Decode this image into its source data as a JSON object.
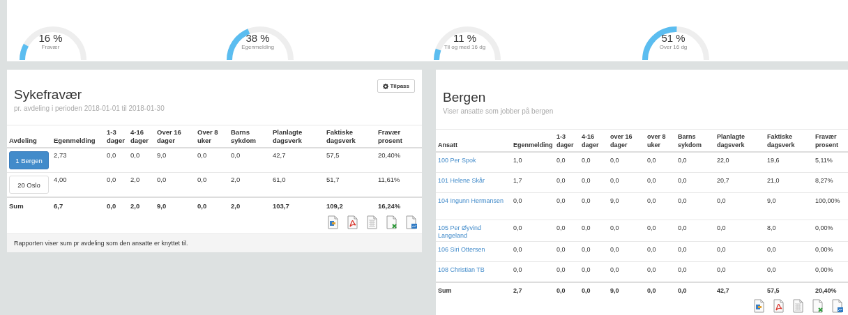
{
  "gauges": [
    {
      "value": "16 %",
      "label": "Fravær"
    },
    {
      "value": "38 %",
      "label": "Egenmelding"
    },
    {
      "value": "11 %",
      "label": "Til og med 16 dg"
    },
    {
      "value": "51 %",
      "label": "Over 16 dg"
    }
  ],
  "department_panel": {
    "title": "Sykefravær",
    "subtitle": "pr. avdeling i perioden 2018-01-01 til 2018-01-30",
    "customize_button": "Tilpass",
    "columns": [
      "Avdeling",
      "Egenmelding",
      "1-3 dager",
      "4-16 dager",
      "Over 16 dager",
      "Over 8 uker",
      "Barns sykdom",
      "Planlagte dagsverk",
      "Faktiske dagsverk",
      "Fravær prosent"
    ],
    "rows": [
      {
        "selected": true,
        "cells": [
          "1 Bergen",
          "2,73",
          "0,0",
          "0,0",
          "9,0",
          "0,0",
          "0,0",
          "42,7",
          "57,5",
          "20,40%"
        ]
      },
      {
        "selected": false,
        "cells": [
          "20 Oslo",
          "4,00",
          "0,0",
          "2,0",
          "0,0",
          "0,0",
          "2,0",
          "61,0",
          "51,7",
          "11,61%"
        ]
      }
    ],
    "sum": [
      "Sum",
      "6,7",
      "0,0",
      "2,0",
      "9,0",
      "0,0",
      "2,0",
      "103,7",
      "109,2",
      "16,24%"
    ],
    "footer": "Rapporten viser sum pr avdeling som den ansatte er knyttet til."
  },
  "employee_panel": {
    "title": "Bergen",
    "subtitle": "Viser ansatte som jobber på bergen",
    "columns": [
      "Ansatt",
      "Egenmelding",
      "1-3 dager",
      "4-16 dager",
      "over 16 dager",
      "over 8 uker",
      "Barns sykdom",
      "Planlagte dagsverk",
      "Faktiske dagsverk",
      "Fravær prosent"
    ],
    "rows": [
      {
        "cells": [
          "100 Per Spok",
          "1,0",
          "0,0",
          "0,0",
          "0,0",
          "0,0",
          "0,0",
          "22,0",
          "19,6",
          "5,11%"
        ]
      },
      {
        "cells": [
          "101 Helene Skår",
          "1,7",
          "0,0",
          "0,0",
          "0,0",
          "0,0",
          "0,0",
          "20,7",
          "21,0",
          "8,27%"
        ]
      },
      {
        "cells": [
          "104 Ingunn Hermansen",
          "0,0",
          "0,0",
          "0,0",
          "9,0",
          "0,0",
          "0,0",
          "0,0",
          "9,0",
          "100,00%"
        ]
      },
      {
        "cells": [
          "105 Per Øyvind Langeland",
          "0,0",
          "0,0",
          "0,0",
          "0,0",
          "0,0",
          "0,0",
          "0,0",
          "8,0",
          "0,00%"
        ]
      },
      {
        "cells": [
          "106 Siri Ottersen",
          "0,0",
          "0,0",
          "0,0",
          "0,0",
          "0,0",
          "0,0",
          "0,0",
          "0,0",
          "0,00%"
        ]
      },
      {
        "cells": [
          "108 Christian TB",
          "0,0",
          "0,0",
          "0,0",
          "0,0",
          "0,0",
          "0,0",
          "0,0",
          "0,0",
          "0,00%"
        ]
      }
    ],
    "sum": [
      "Sum",
      "2,7",
      "0,0",
      "0,0",
      "9,0",
      "0,0",
      "0,0",
      "42,7",
      "57,5",
      "20,40%"
    ]
  }
}
